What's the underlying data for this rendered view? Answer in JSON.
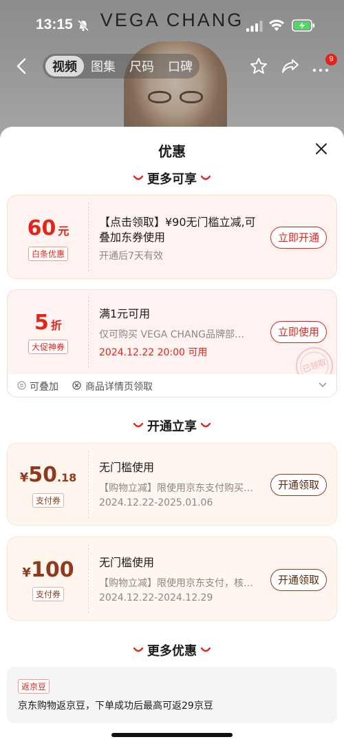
{
  "status_bar": {
    "time": "13:15"
  },
  "product_page": {
    "brand": "VEGA CHANG",
    "tabs": [
      {
        "label": "视频"
      },
      {
        "label": "图集"
      },
      {
        "label": "尺码"
      },
      {
        "label": "口碑"
      }
    ],
    "cart_badge": "9"
  },
  "sheet": {
    "title": "优惠",
    "sections": {
      "more_available": "更多可享",
      "open_enjoy": "开通立享",
      "more_offers": "更多优惠"
    },
    "coupons": [
      {
        "amount": "60",
        "unit": "元",
        "tag": "白条优惠",
        "title": "【点击领取】¥90无门槛立减,可叠加东券使用",
        "sub": "开通后7天有效",
        "button": "立即开通"
      },
      {
        "amount": "5",
        "unit": "折",
        "tag": "大促神券",
        "title": "满1元可用",
        "sub": "仅可购买 VEGA CHANG品牌部…",
        "date": "2024.12.22 20:00 可用",
        "button": "立即使用",
        "stamp": "已领取",
        "footer": {
          "stackable": "可叠加",
          "source": "商品详情页领取"
        }
      },
      {
        "currency": "¥",
        "amount": "50",
        "decimal": ".18",
        "tag": "支付券",
        "title": "无门槛使用",
        "sub": "【购物立减】限使用京东支付购买…",
        "date": "2024.12.22-2025.01.06",
        "button": "开通领取"
      },
      {
        "currency": "¥",
        "amount": "100",
        "tag": "支付券",
        "title": "无门槛使用",
        "sub": "【购物立减】限使用京东支付，核…",
        "date": "2024.12.22-2024.12.29",
        "button": "开通领取"
      }
    ],
    "more_offer": {
      "tag": "返京豆",
      "text": "京东购物返京豆，下单成功后最高可返29京豆"
    }
  },
  "colors": {
    "accent_red": "#e1251b",
    "brown": "#8f3b1b"
  }
}
